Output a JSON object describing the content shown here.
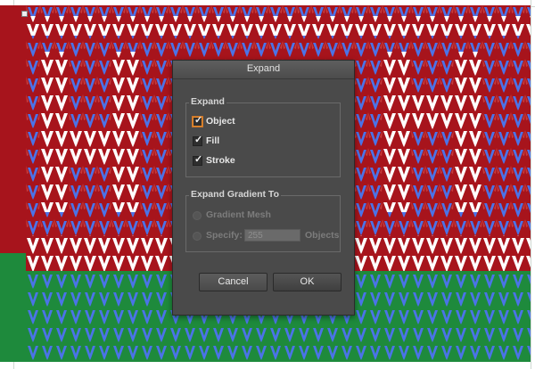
{
  "dialog": {
    "title": "Expand",
    "expand_group": {
      "label": "Expand",
      "options": [
        {
          "label": "Object",
          "checked": true,
          "focused": true
        },
        {
          "label": "Fill",
          "checked": true,
          "focused": false
        },
        {
          "label": "Stroke",
          "checked": true,
          "focused": false
        }
      ]
    },
    "gradient_group": {
      "label": "Expand Gradient To",
      "gradient_mesh_label": "Gradient Mesh",
      "specify_label": "Specify:",
      "specify_value": "255",
      "objects_label": "Objects",
      "enabled": false
    },
    "buttons": {
      "cancel": "Cancel",
      "ok": "OK"
    }
  },
  "artwork": {
    "colors": {
      "red": "#a7141c",
      "green": "#1e8a3c",
      "knit_blue": "#4b73e8",
      "knit_white": "#ffffff",
      "dialog_bg": "#4a4a4a"
    }
  },
  "icons": {
    "check": "✓"
  }
}
